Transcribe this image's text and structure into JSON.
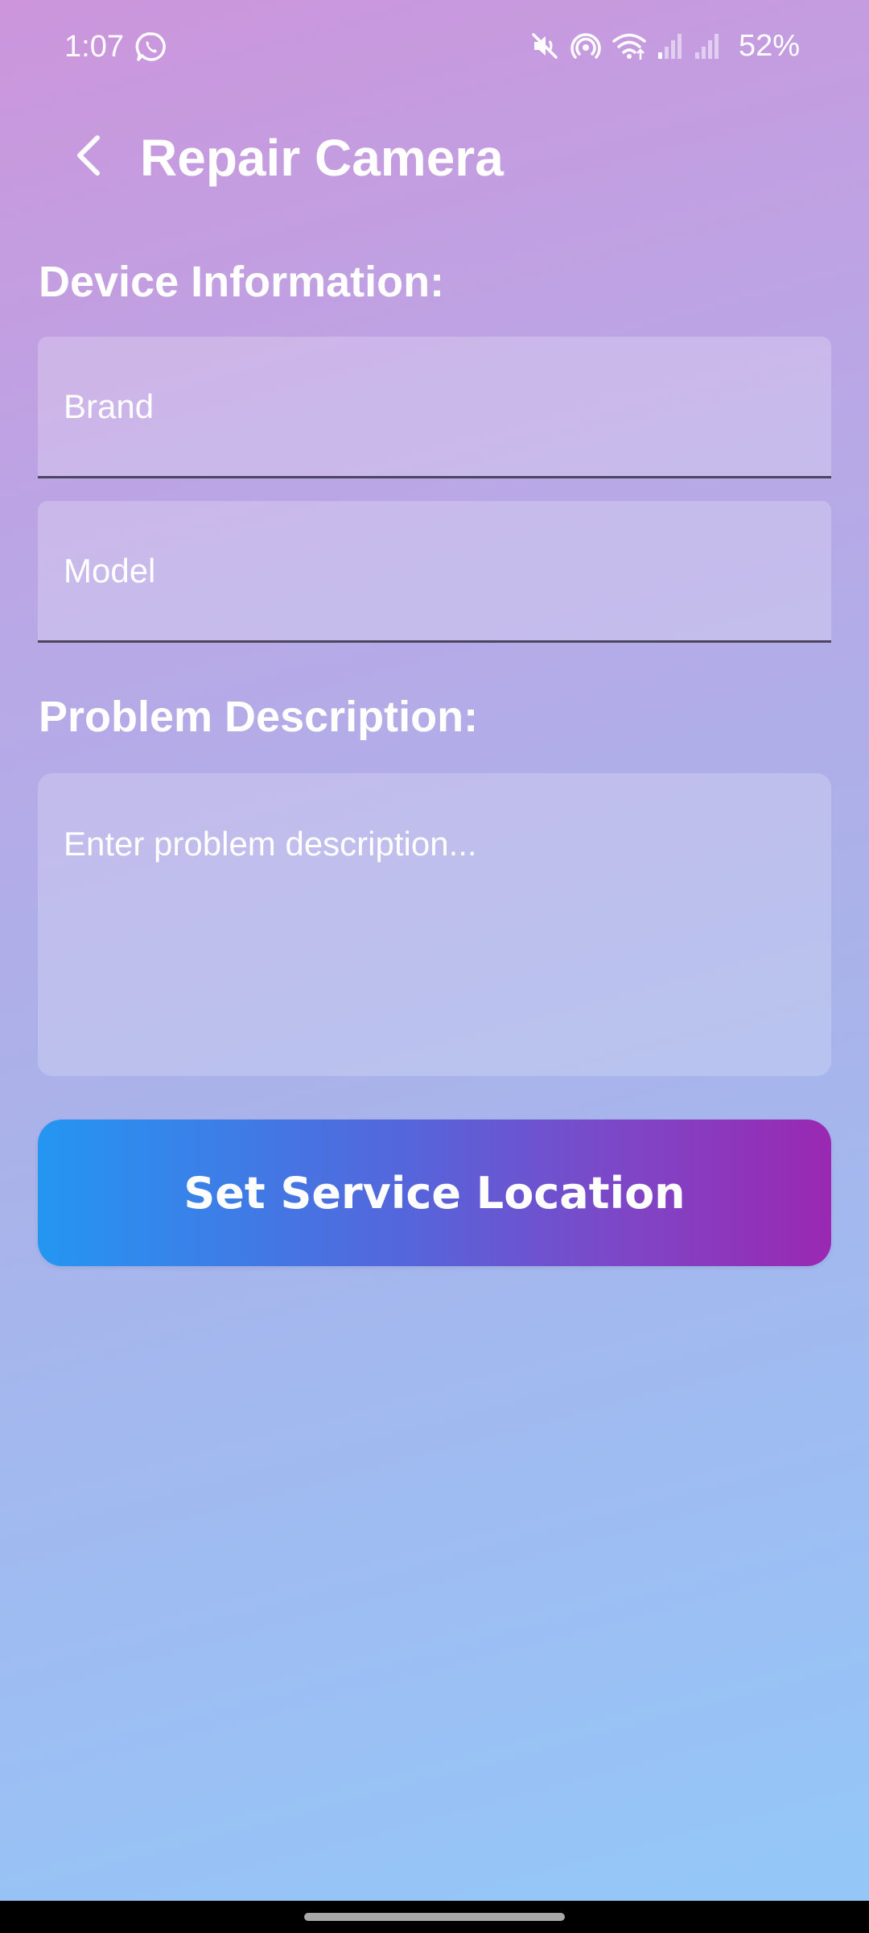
{
  "status_bar": {
    "time": "1:07",
    "battery": "52%",
    "icons": [
      "whatsapp-icon",
      "mute-icon",
      "hotspot-icon",
      "wifi-icon",
      "signal-icon",
      "signal-icon",
      "battery-text"
    ]
  },
  "header": {
    "title": "Repair Camera",
    "back_icon": "chevron-left-icon"
  },
  "device_section": {
    "label": "Device Information:",
    "brand_placeholder": "Brand",
    "brand_value": "",
    "model_placeholder": "Model",
    "model_value": ""
  },
  "problem_section": {
    "label": "Problem Description:",
    "placeholder": "Enter problem description...",
    "value": ""
  },
  "actions": {
    "set_location_label": "Set Service Location"
  },
  "colors": {
    "background_top": "#cc95dc",
    "background_bottom": "#93c8f9",
    "button_start": "#2496f2",
    "button_end": "#9a28b2",
    "field_underline": "#4c4560"
  }
}
